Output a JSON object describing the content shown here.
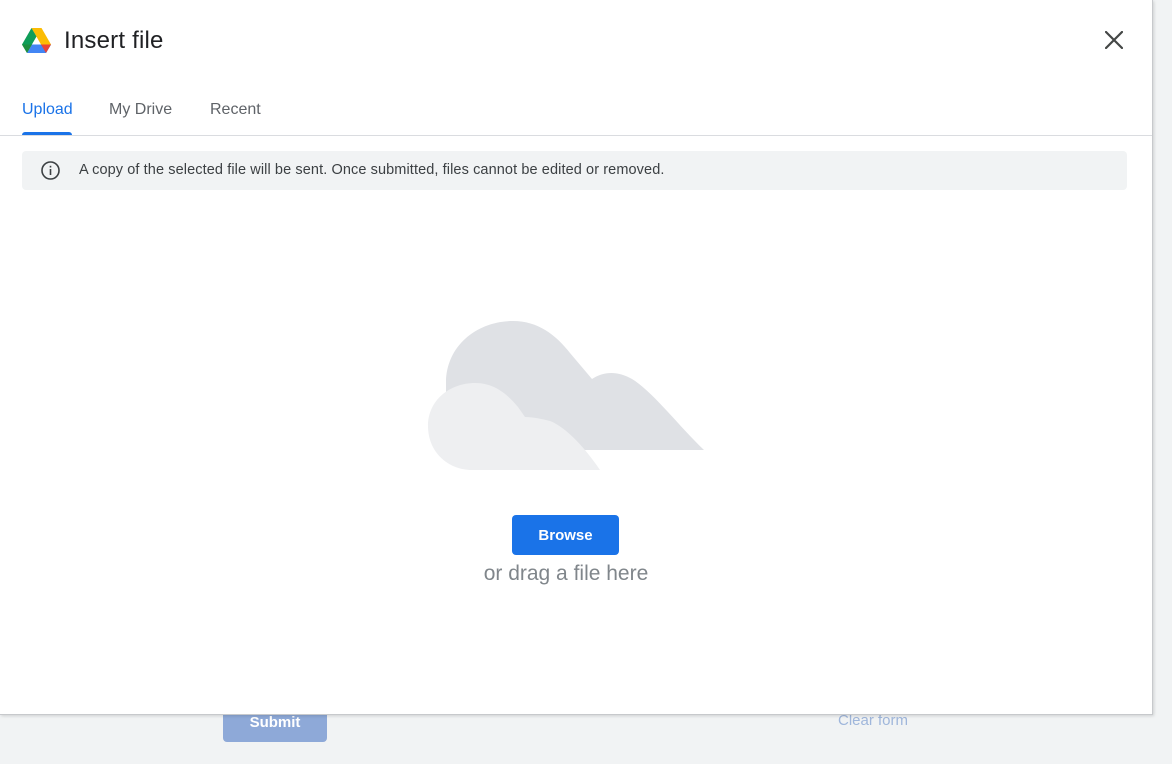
{
  "background": {
    "submit_label": "Submit",
    "clear_label": "Clear form"
  },
  "dialog": {
    "title": "Insert file",
    "logo_icon": "google-drive-icon",
    "close_icon": "close-icon"
  },
  "tabs": [
    {
      "label": "Upload",
      "active": true
    },
    {
      "label": "My Drive",
      "active": false
    },
    {
      "label": "Recent",
      "active": false
    }
  ],
  "info": {
    "icon": "info-icon",
    "text": "A copy of the selected file will be sent. Once submitted, files cannot be edited or removed."
  },
  "upload": {
    "illustration": "cloud-icon",
    "browse_label": "Browse",
    "drag_text": "or drag a file here"
  },
  "colors": {
    "accent": "#1a73e8",
    "info_bg": "#f1f3f4",
    "muted_text": "#5f6368"
  }
}
